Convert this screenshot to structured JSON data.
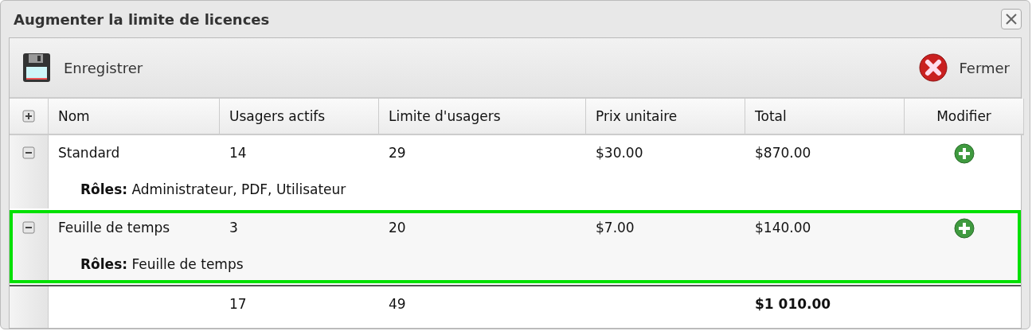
{
  "window": {
    "title": "Augmenter la limite de licences"
  },
  "toolbar": {
    "save": "Enregistrer",
    "close": "Fermer"
  },
  "table": {
    "columns": [
      "Nom",
      "Usagers actifs",
      "Limite d'usagers",
      "Prix unitaire",
      "Total",
      "Modifier"
    ],
    "rows": [
      {
        "name": "Standard",
        "active": "14",
        "limit": "29",
        "unit_price": "$30.00",
        "total": "$870.00",
        "roles": "**Rôles:** Administrateur, PDF, Utilisateur",
        "expanded": true,
        "selected": false
      },
      {
        "name": "Feuille de temps",
        "active": "3",
        "limit": "20",
        "unit_price": "$7.00",
        "total": "$140.00",
        "roles": "**Rôles:** Feuille de temps",
        "expanded": true,
        "selected": true
      }
    ],
    "footer": {
      "active": "17",
      "limit": "49",
      "total": "$1 010.00"
    }
  }
}
